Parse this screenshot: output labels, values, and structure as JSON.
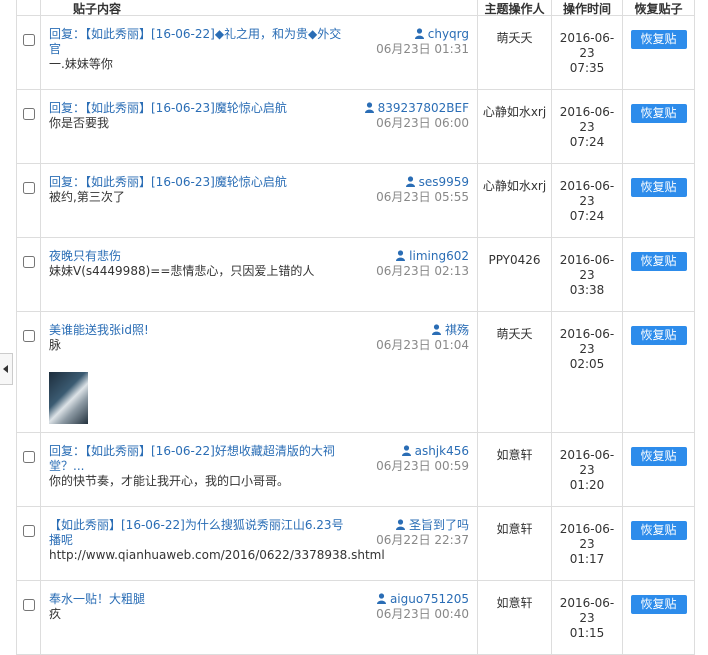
{
  "headers": {
    "content": "贴子内容",
    "operator": "主题操作人",
    "time": "操作时间",
    "restore": "恢复贴子"
  },
  "restore_label": "恢复贴",
  "rows": [
    {
      "title": "回复：【如此秀丽】[16-06-22]◆礼之用，和为贵◆外交官",
      "body": "一.妹妹等你",
      "author": "chyqrg",
      "post_time": "06月23日 01:31",
      "operator": "萌夭夭",
      "op_time": "2016-06-23 07:35"
    },
    {
      "title": "回复：【如此秀丽】[16-06-23]魔轮惊心启航",
      "body": "你是否要我",
      "author": "839237802BEF",
      "post_time": "06月23日 06:00",
      "operator": "心静如水xrj",
      "op_time": "2016-06-23 07:24"
    },
    {
      "title": "回复：【如此秀丽】[16-06-23]魔轮惊心启航",
      "body": "被约,第三次了",
      "author": "ses9959",
      "post_time": "06月23日 05:55",
      "operator": "心静如水xrj",
      "op_time": "2016-06-23 07:24"
    },
    {
      "title": "夜晚只有悲伤",
      "body": "妹妹V(s4449988)==悲情悲心，只因爱上错的人",
      "author": "liming602",
      "post_time": "06月23日 02:13",
      "operator": "PPY0426",
      "op_time": "2016-06-23 03:38"
    },
    {
      "title": "美谁能送我张id照!",
      "body": "脉",
      "author": "祺殇",
      "post_time": "06月23日 01:04",
      "operator": "萌夭夭",
      "op_time": "2016-06-23 02:05",
      "has_image": true
    },
    {
      "title": "回复：【如此秀丽】[16-06-22]好想收藏超清版的大祠堂？...",
      "body": "你的快节奏，才能让我开心，我的口小哥哥。",
      "author": "ashjk456",
      "post_time": "06月23日 00:59",
      "operator": "如意轩",
      "op_time": "2016-06-23 01:20"
    },
    {
      "title": "【如此秀丽】[16-06-22]为什么搜狐说秀丽江山6.23号播呢",
      "body": "http://www.qianhuaweb.com/2016/0622/3378938.shtml",
      "author": "圣旨到了吗",
      "post_time": "06月22日 22:37",
      "operator": "如意轩",
      "op_time": "2016-06-23 01:17"
    },
    {
      "title": "奉水一贴！大粗腿",
      "body": "疚",
      "author": "aiguo751205",
      "post_time": "06月23日 00:40",
      "operator": "如意轩",
      "op_time": "2016-06-23 01:15"
    }
  ]
}
